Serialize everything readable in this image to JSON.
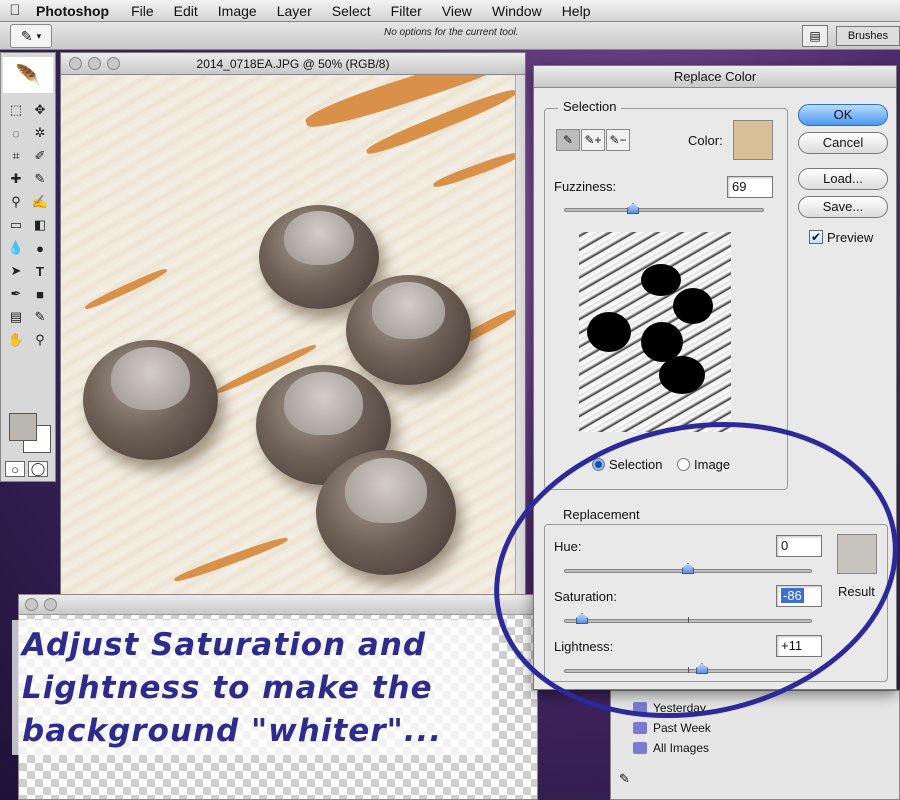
{
  "menubar": {
    "apple_icon": "",
    "app_name": "Photoshop",
    "items": [
      "File",
      "Edit",
      "Image",
      "Layer",
      "Select",
      "Filter",
      "View",
      "Window",
      "Help"
    ]
  },
  "options_bar": {
    "message": "No options for the current tool.",
    "palette_label": "Brushes"
  },
  "document": {
    "title": "2014_0718EA.JPG @ 50% (RGB/8)"
  },
  "dialog": {
    "title": "Replace Color",
    "selection_group": "Selection",
    "color_label": "Color:",
    "color_swatch": "#d8bf98",
    "fuzziness_label": "Fuzziness:",
    "fuzziness_value": "69",
    "fuzziness_level": 0.69,
    "radio_selection": "Selection",
    "radio_image": "Image",
    "replacement_group": "Replacement",
    "hue_label": "Hue:",
    "hue_value": "0",
    "saturation_label": "Saturation:",
    "saturation_value": "-86",
    "lightness_label": "Lightness:",
    "lightness_value": "+11",
    "result_label": "Result",
    "result_swatch": "#c7c4bf",
    "ok_label": "OK",
    "cancel_label": "Cancel",
    "load_label": "Load...",
    "save_label": "Save...",
    "preview_label": "Preview"
  },
  "bg_panel": {
    "items": [
      "Yesterday",
      "Past Week",
      "All Images"
    ]
  },
  "caption": {
    "text": "Adjust Saturation and Lightness to make the background \"whiter\"..."
  },
  "colors": {
    "annotation": "#2c2a9a",
    "accent": "#4b97ee"
  }
}
